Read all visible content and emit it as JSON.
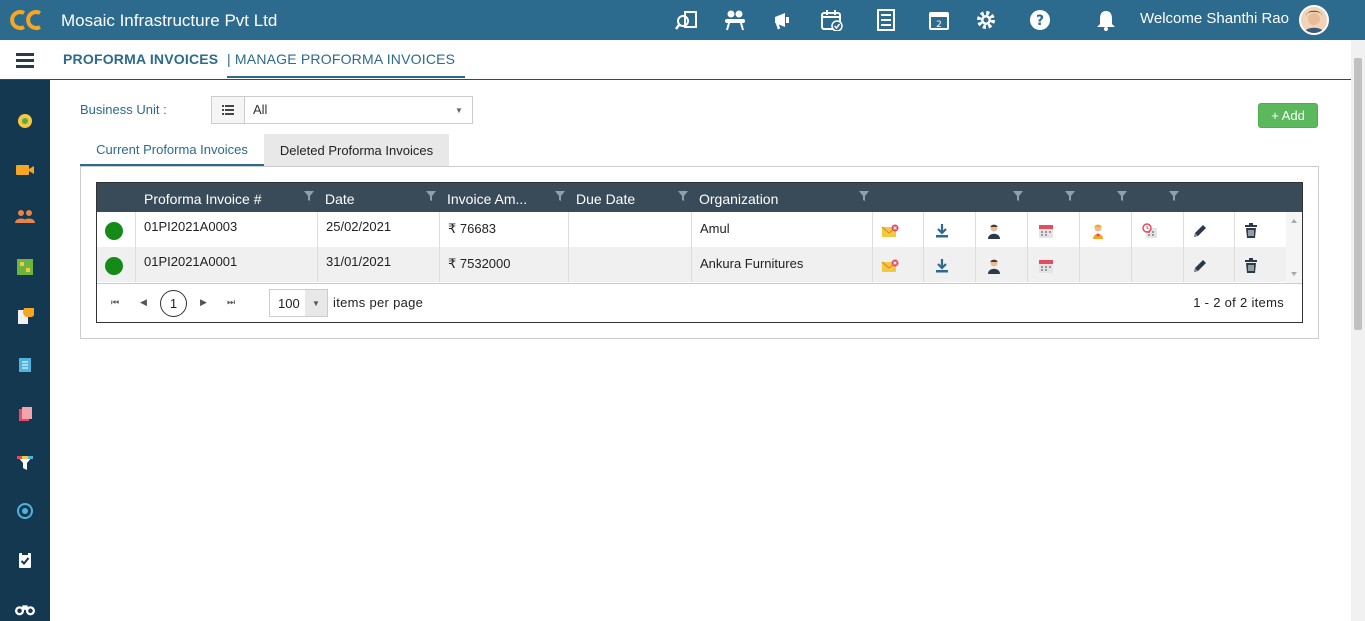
{
  "header": {
    "company": "Mosaic Infrastructure Pvt Ltd",
    "welcome": "Welcome Shanthi Rao",
    "icons": [
      "search-document-icon",
      "meeting-icon",
      "megaphone-icon",
      "calendar-check-icon",
      "list-document-icon",
      "calendar-day-icon",
      "gear-icon",
      "help-icon",
      "bell-icon"
    ]
  },
  "breadcrumb": {
    "section": "PROFORMA INVOICES",
    "page": "| MANAGE PROFORMA INVOICES"
  },
  "filters": {
    "business_unit_label": "Business Unit :",
    "business_unit_value": "All"
  },
  "add_label": "+ Add",
  "tabs": {
    "current": "Current Proforma Invoices",
    "deleted": "Deleted Proforma Invoices"
  },
  "grid": {
    "columns": [
      "Proforma Invoice #",
      "Date",
      "Invoice Am...",
      "Due Date",
      "Organization"
    ],
    "rows": [
      {
        "status": "green",
        "invoice": "01PI2021A0003",
        "date": "25/02/2021",
        "amount": "₹ 76683",
        "due": "",
        "org": "Amul"
      },
      {
        "status": "green",
        "invoice": "01PI2021A0001",
        "date": "31/01/2021",
        "amount": "₹ 7532000",
        "due": "",
        "org": "Ankura Furnitures"
      }
    ]
  },
  "pager": {
    "current_page": "1",
    "page_size": "100",
    "items_per_page": "items per page",
    "info": "1 - 2 of 2 items"
  },
  "colors": {
    "topbar": "#2c6a8e",
    "sidebar": "#14384f",
    "grid_header": "#394b59",
    "status_green": "#168a16",
    "add_green": "#5cb85c"
  }
}
